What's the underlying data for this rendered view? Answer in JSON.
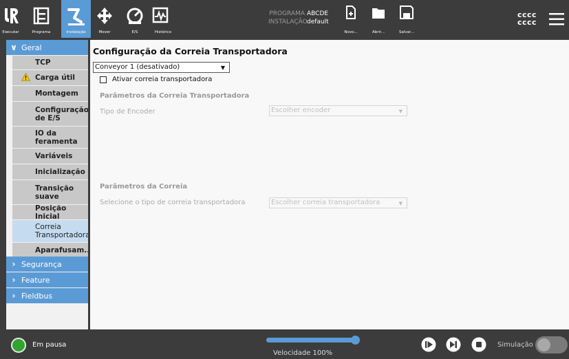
{
  "colors": {
    "accent": "#5b9bd5",
    "topbar_bg": "#3c3c3c",
    "status_green": "#2fa52f"
  },
  "toolbar": {
    "run_label": "Executar",
    "program_label": "Programa",
    "install_label": "Instalação",
    "move_label": "Mover",
    "io_label": "E/S",
    "log_label": "Histórico",
    "new_label": "Novo...",
    "open_label": "Abrir...",
    "save_label": "Salvar..."
  },
  "program_info": {
    "program_key": "PROGRAMA",
    "program_value": "ABCDE",
    "install_key": "INSTALAÇÃO",
    "install_value": "default"
  },
  "user": {
    "line1": "cccc",
    "line2": "cccc"
  },
  "sidebar": {
    "general": "Geral",
    "items": [
      {
        "label": "TCP"
      },
      {
        "label": "Carga útil",
        "warning": true
      },
      {
        "label": "Montagem"
      },
      {
        "label": "Configuração\nde E/S"
      },
      {
        "label": "IO da\nferamenta"
      },
      {
        "label": "Variáveis"
      },
      {
        "label": "Inicialização"
      },
      {
        "label": "Transição\nsuave"
      },
      {
        "label": "Posição Inicial"
      },
      {
        "label": "Correia\nTransportadora",
        "active": true
      },
      {
        "label": "Aparafusam..."
      }
    ],
    "safety": "Segurança",
    "feature": "Feature",
    "fieldbus": "Fieldbus"
  },
  "main": {
    "title": "Configuração da Correia Transportadora",
    "conveyor_selected": "Conveyor 1 (desativado)",
    "enable_label": "Ativar correia transportadora",
    "enable_checked": false,
    "params_title": "Parâmetros da Correia Transportadora",
    "encoder_label": "Tipo de Encoder",
    "encoder_placeholder": "Escolher encoder",
    "belt_params_title": "Parâmetros da Correia",
    "belt_type_label": "Selecione o tipo de correia transportadora",
    "belt_type_placeholder": "Escolher correia transportadora"
  },
  "status": {
    "state": "Em pausa",
    "speed_label": "Velocidade 100%",
    "speed_fraction": 1.0,
    "simulation_label": "Simulação",
    "simulation_on": false
  }
}
